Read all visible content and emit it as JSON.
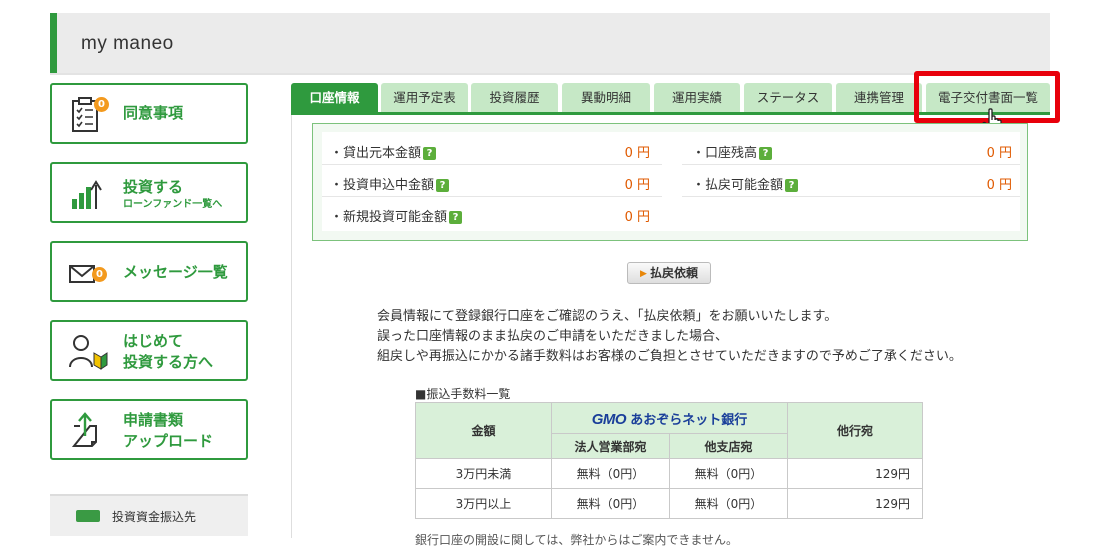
{
  "header": {
    "title": "my maneo"
  },
  "sidebar": {
    "consent": {
      "label": "同意事項",
      "badge": "0"
    },
    "invest": {
      "label": "投資する",
      "sub": "ローンファンド一覧へ"
    },
    "messages": {
      "label": "メッセージ一覧",
      "badge": "0"
    },
    "beginners": {
      "line1": "はじめて",
      "line2": "投資する方へ"
    },
    "upload": {
      "line1": "申請書類",
      "line2": "アップロード"
    },
    "transfer": {
      "label": "投資資金振込先"
    }
  },
  "tabs": [
    {
      "label": "口座情報",
      "active": true
    },
    {
      "label": "運用予定表"
    },
    {
      "label": "投資履歴"
    },
    {
      "label": "異動明細"
    },
    {
      "label": "運用実績"
    },
    {
      "label": "ステータス"
    },
    {
      "label": "連携管理"
    },
    {
      "label": "電子交付書面一覧"
    }
  ],
  "summary": {
    "loan_principal": {
      "label": "・貸出元本金額",
      "value": "0 円"
    },
    "account_balance": {
      "label": "・口座残高",
      "value": "0 円"
    },
    "pending_investment": {
      "label": "・投資申込中金額",
      "value": "0 円"
    },
    "withdrawable": {
      "label": "・払戻可能金額",
      "value": "0 円"
    },
    "new_investable": {
      "label": "・新規投資可能金額",
      "value": "0 円"
    },
    "help_mark": "?"
  },
  "refund_button": {
    "label": "払戻依頼"
  },
  "notice": {
    "line1": "会員情報にて登録銀行口座をご確認のうえ、「払戻依頼」をお願いいたします。",
    "line2": "誤った口座情報のまま払戻のご申請をいただきました場合、",
    "line3": "組戻しや再振込にかかる諸手数料はお客様のご負担とさせていただきますので予めご了承ください。"
  },
  "fee_table": {
    "title": "■振込手数料一覧",
    "col_amount": "金額",
    "gmo_logo": "GMO",
    "gmo_bank_name": "あおぞらネット銀行",
    "col_corporate": "法人営業部宛",
    "col_branch": "他支店宛",
    "col_other": "他行宛",
    "rows": [
      {
        "amount": "3万円未満",
        "corporate": "無料（0円）",
        "branch": "無料（0円）",
        "other": "129円"
      },
      {
        "amount": "3万円以上",
        "corporate": "無料（0円）",
        "branch": "無料（0円）",
        "other": "129円"
      }
    ]
  },
  "footer_note": "銀行口座の開設に関しては、弊社からはご案内できません。",
  "colors": {
    "brand_green": "#2f9a3e",
    "tab_inactive": "#c6e8c6",
    "highlight_red": "#e8000b",
    "badge_orange": "#f39a1e",
    "value_orange": "#e05a00"
  }
}
